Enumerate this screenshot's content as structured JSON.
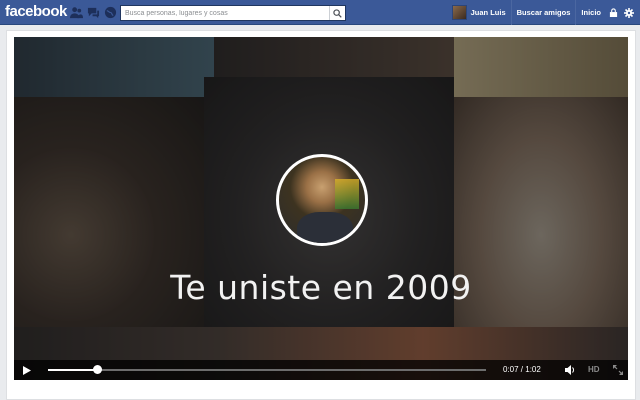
{
  "topbar": {
    "logo": "facebook",
    "search_placeholder": "Busca personas, lugares y cosas",
    "nav": {
      "profile_name": "Juan Luis",
      "find_friends": "Buscar amigos",
      "home": "Inicio"
    },
    "icons": [
      "friend-requests-icon",
      "messages-icon",
      "notifications-globe-icon",
      "privacy-lock-icon",
      "settings-gear-icon"
    ]
  },
  "video": {
    "headline": "Te uniste en 2009",
    "controls": {
      "current_time": "0:07",
      "duration": "1:02",
      "time_label": "0:07 / 1:02",
      "progress": 0.113,
      "hd_label": "HD"
    }
  },
  "colors": {
    "brand_blue": "#3b5998",
    "page_bg": "#e9ebee",
    "controls_bg": "#000000"
  }
}
